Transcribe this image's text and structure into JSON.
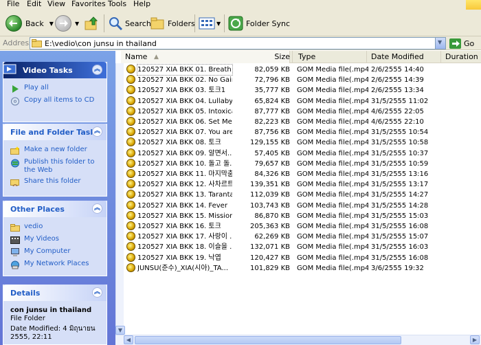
{
  "menu": [
    "File",
    "Edit",
    "View",
    "Favorites",
    "Tools",
    "Help"
  ],
  "toolbar": {
    "back_label": "Back",
    "search_label": "Search",
    "folders_label": "Folders",
    "sync_label": "Folder Sync"
  },
  "address": {
    "label": "Address",
    "path": "E:\\vedio\\con junsu in thailand",
    "go_label": "Go"
  },
  "task_panels": {
    "video": {
      "title": "Video Tasks",
      "items": [
        "Play all",
        "Copy all items to CD"
      ]
    },
    "file_folder": {
      "title": "File and Folder Tasks",
      "items": [
        "Make a new folder",
        "Publish this folder to the Web",
        "Share this folder"
      ]
    },
    "other": {
      "title": "Other Places",
      "items": [
        "vedio",
        "My Videos",
        "My Computer",
        "My Network Places"
      ]
    },
    "details": {
      "title": "Details",
      "name": "con junsu in thailand",
      "type": "File Folder",
      "modified": "Date Modified: 4 มิถุนายน 2555, 22:11"
    }
  },
  "columns": {
    "name": "Name",
    "size": "Size",
    "type": "Type",
    "date": "Date Modified",
    "duration": "Duration"
  },
  "files": [
    {
      "name": "120527 XIA BKK 01. Breath",
      "size": "82,059 KB",
      "type": "GOM Media file(.mp4)",
      "date": "2/6/2555 14:40"
    },
    {
      "name": "120527 XIA BKK 02. No Gain",
      "size": "72,796 KB",
      "type": "GOM Media file(.mp4)",
      "date": "2/6/2555 14:39"
    },
    {
      "name": "120527 XIA BKK 03. 토크1",
      "size": "35,777 KB",
      "type": "GOM Media file(.mp4)",
      "date": "2/6/2555 13:34"
    },
    {
      "name": "120527 XIA BKK 04. Lullaby",
      "size": "65,824 KB",
      "type": "GOM Media file(.mp4)",
      "date": "31/5/2555 11:02"
    },
    {
      "name": "120527 XIA BKK 05. Intoxication",
      "size": "87,777 KB",
      "type": "GOM Media file(.mp4)",
      "date": "4/6/2555 22:05"
    },
    {
      "name": "120527 XIA BKK 06. Set Me F...",
      "size": "82,223 KB",
      "type": "GOM Media file(.mp4)",
      "date": "4/6/2555 22:10"
    },
    {
      "name": "120527 XIA BKK 07. You are s...",
      "size": "87,756 KB",
      "type": "GOM Media file(.mp4)",
      "date": "31/5/2555 10:54"
    },
    {
      "name": "120527 XIA BKK 08. 토크",
      "size": "129,155 KB",
      "type": "GOM Media file(.mp4)",
      "date": "31/5/2555 10:58"
    },
    {
      "name": "120527 XIA BKK 09. 알면서...",
      "size": "57,405 KB",
      "type": "GOM Media file(.mp4)",
      "date": "31/5/2555 10:37"
    },
    {
      "name": "120527 XIA BKK 10. 돌고 돌...",
      "size": "79,657 KB",
      "type": "GOM Media file(.mp4)",
      "date": "31/5/2555 10:59"
    },
    {
      "name": "120527 XIA BKK 11. 마지막춤",
      "size": "84,326 KB",
      "type": "GOM Media file(.mp4)",
      "date": "31/5/2555 13:16"
    },
    {
      "name": "120527 XIA BKK 12. 사차르트_",
      "size": "139,351 KB",
      "type": "GOM Media file(.mp4)",
      "date": "31/5/2555 13:17"
    },
    {
      "name": "120527 XIA BKK 13. Tarantall...",
      "size": "112,039 KB",
      "type": "GOM Media file(.mp4)",
      "date": "31/5/2555 14:27"
    },
    {
      "name": "120527 XIA BKK 14. Fever",
      "size": "103,743 KB",
      "type": "GOM Media file(.mp4)",
      "date": "31/5/2555 14:28"
    },
    {
      "name": "120527 XIA BKK 15. Mission",
      "size": "86,870 KB",
      "type": "GOM Media file(.mp4)",
      "date": "31/5/2555 15:03"
    },
    {
      "name": "120527 XIA BKK 16. 토크",
      "size": "205,363 KB",
      "type": "GOM Media file(.mp4)",
      "date": "31/5/2555 16:08"
    },
    {
      "name": "120527 XIA BKK 17. 사랑이 ...",
      "size": "62,269 KB",
      "type": "GOM Media file(.mp4)",
      "date": "31/5/2555 15:07"
    },
    {
      "name": "120527 XIA BKK 18. 이슬을 ...",
      "size": "132,071 KB",
      "type": "GOM Media file(.mp4)",
      "date": "31/5/2555 16:03"
    },
    {
      "name": "120527 XIA BKK 19. 낙엽",
      "size": "120,427 KB",
      "type": "GOM Media file(.mp4)",
      "date": "31/5/2555 16:08"
    },
    {
      "name": "JUNSU(준수)_XIA(시아)_TA...",
      "size": "101,829 KB",
      "type": "GOM Media file(.mp4)",
      "date": "3/6/2555 19:32"
    }
  ]
}
